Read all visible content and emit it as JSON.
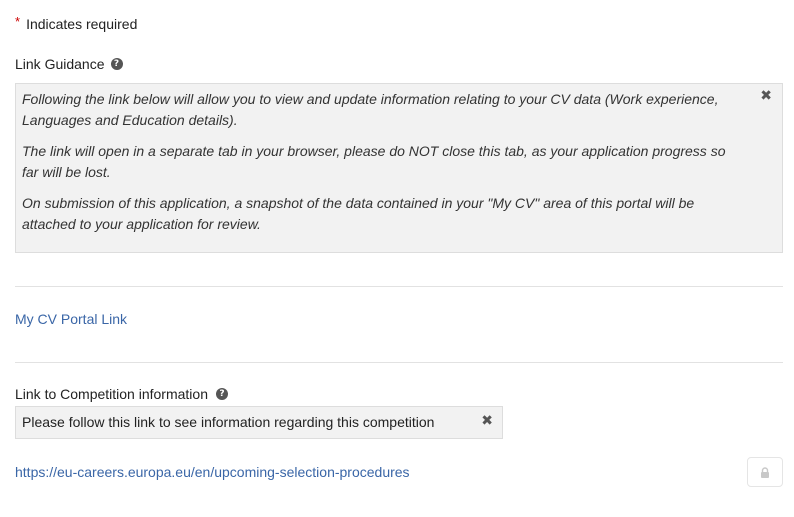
{
  "required_note": {
    "star": "*",
    "text": "Indicates required"
  },
  "link_guidance": {
    "label": "Link Guidance",
    "help_icon": "?",
    "paragraphs": [
      "Following the link below will allow you to view and update information relating to your CV data (Work experience, Languages and Education details).",
      "The link will open in a separate tab in your browser, please do NOT close this tab, as your application progress so far will be lost.",
      "On submission of this application, a snapshot of the data contained in your \"My CV\" area of this portal will be attached to your application for review."
    ],
    "close_icon": "✖"
  },
  "cv_link": {
    "text": "My CV Portal Link"
  },
  "competition": {
    "label": "Link to Competition information",
    "help_icon": "?",
    "note": "Please follow this link to see information regarding this competition",
    "close_icon": "✖",
    "link_text": "https://eu-careers.europa.eu/en/upcoming-selection-procedures"
  },
  "colors": {
    "link": "#3a66a7",
    "required_star": "#cc0000",
    "panel_bg": "#f2f2f2"
  },
  "icons": [
    "help-icon",
    "close-icon",
    "lock-icon"
  ]
}
